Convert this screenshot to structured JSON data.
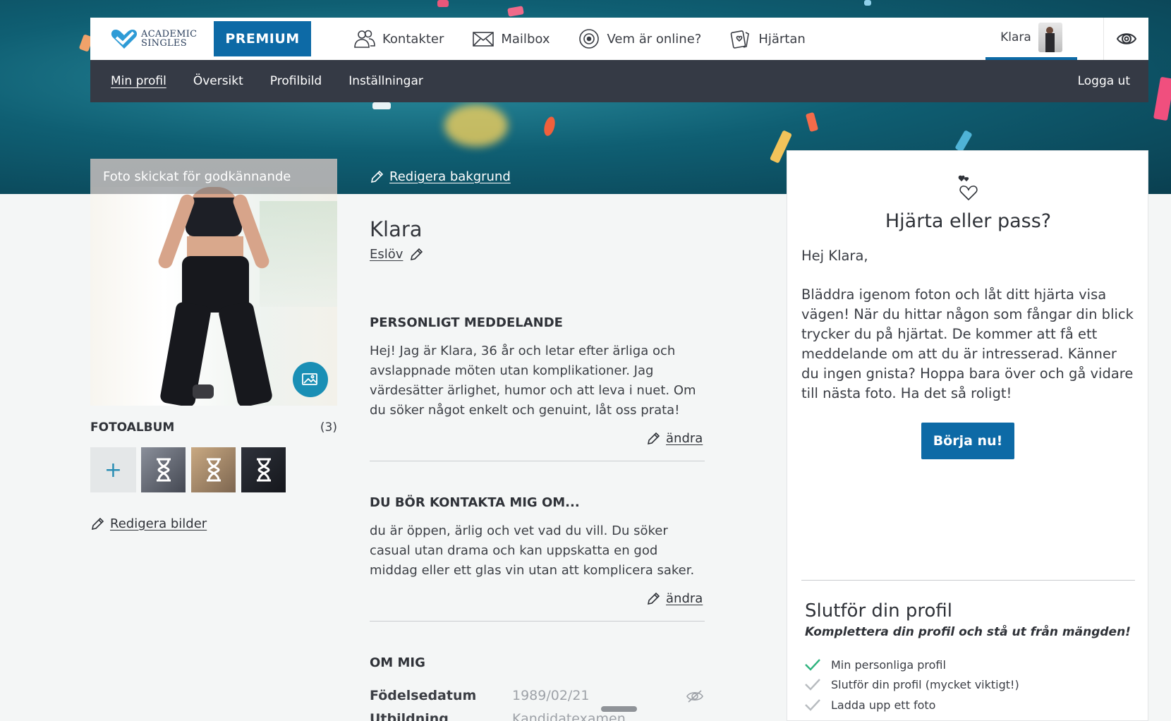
{
  "brand": {
    "logo_line1": "ACADEMIC",
    "logo_line2": "SINGLES",
    "premium_label": "PREMIUM",
    "accent": "#0d6aa6"
  },
  "topnav": {
    "items": [
      {
        "label": "Kontakter",
        "icon": "contacts-icon"
      },
      {
        "label": "Mailbox",
        "icon": "mail-icon"
      },
      {
        "label": "Vem är online?",
        "icon": "online-icon"
      },
      {
        "label": "Hjärtan",
        "icon": "hearts-icon"
      }
    ],
    "user_name": "Klara"
  },
  "subnav": {
    "items": [
      "Min profil",
      "Översikt",
      "Profilbild",
      "Inställningar"
    ],
    "logout": "Logga ut"
  },
  "photo": {
    "caption": "Foto skickat för godkännande"
  },
  "album": {
    "title": "FOTOALBUM",
    "count": "(3)",
    "add_symbol": "+",
    "edit_label": "Redigera bilder"
  },
  "profile": {
    "edit_background": "Redigera bakgrund",
    "name": "Klara",
    "city": "Eslöv",
    "sections": [
      {
        "title": "PERSONLIGT MEDDELANDE",
        "text": "Hej! Jag är Klara, 36 år och letar efter ärliga och avslappnade möten utan komplikationer. Jag värdesätter ärlighet, humor och att leva i nuet. Om du söker något enkelt och genuint, låt oss prata!",
        "edit": "ändra"
      },
      {
        "title": "DU BÖR KONTAKTA MIG OM...",
        "text": "du är öppen, ärlig och vet vad du vill. Du söker casual utan drama och kan uppskatta en god middag eller ett glas vin utan att komplicera saker.",
        "edit": "ändra"
      }
    ],
    "about_title": "OM MIG",
    "about_rows": [
      {
        "label": "Födelsedatum",
        "value": "1989/02/21"
      },
      {
        "label": "Utbildning",
        "value": "Kandidatexamen"
      }
    ]
  },
  "heart_card": {
    "title": "Hjärta eller pass?",
    "greeting": "Hej Klara,",
    "body": "Bläddra igenom foton och låt ditt hjärta visa vägen! När du hittar någon som fångar din blick trycker du på hjärtat. De kommer att få ett meddelande om att du är intresserad. Känner du ingen gnista? Hoppa bara över och gå vidare till nästa foto. Ha det så roligt!",
    "button": "Börja nu!"
  },
  "complete_profile": {
    "title": "Slutför din profil",
    "subtitle": "Komplettera din profil och stå ut från mängden!",
    "items": [
      {
        "label": "Min personliga profil",
        "done": true
      },
      {
        "label": "Slutför din profil (mycket viktigt!)",
        "done": false
      },
      {
        "label": "Ladda upp ett foto",
        "done": false
      }
    ]
  }
}
